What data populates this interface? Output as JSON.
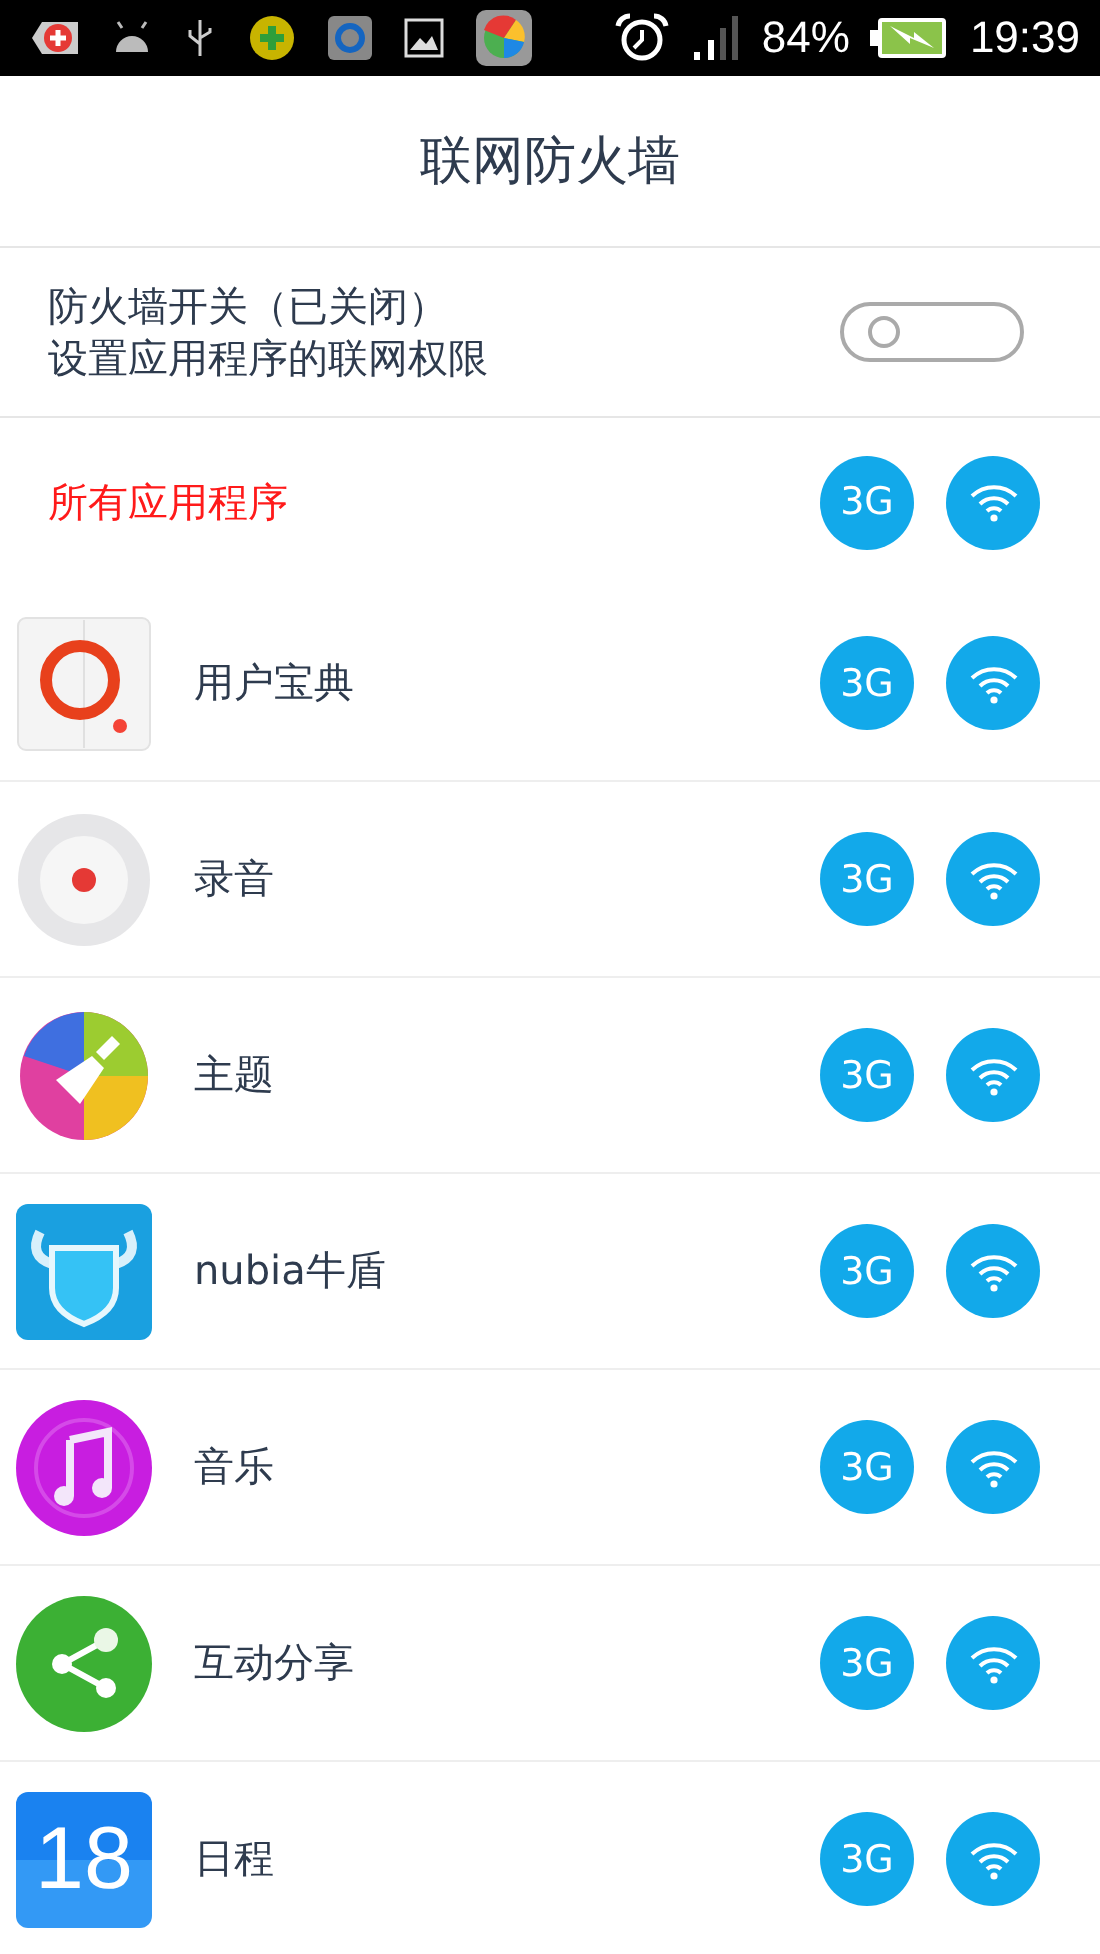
{
  "status_bar": {
    "battery": "84%",
    "time": "19:39"
  },
  "title": "联网防火墙",
  "firewall": {
    "label": "防火墙开关（已关闭）",
    "description": "设置应用程序的联网权限",
    "on": false
  },
  "all_apps": {
    "label": "所有应用程序",
    "mobile_label": "3G",
    "mobile_on": true,
    "wifi_on": true
  },
  "apps": [
    {
      "name": "用户宝典",
      "kind": "book",
      "mobile_label": "3G",
      "mobile_on": true,
      "wifi_on": true
    },
    {
      "name": "录音",
      "kind": "recorder",
      "mobile_label": "3G",
      "mobile_on": true,
      "wifi_on": true
    },
    {
      "name": "主题",
      "kind": "theme",
      "mobile_label": "3G",
      "mobile_on": true,
      "wifi_on": true
    },
    {
      "name": "nubia牛盾",
      "kind": "shield",
      "mobile_label": "3G",
      "mobile_on": true,
      "wifi_on": true
    },
    {
      "name": "音乐",
      "kind": "music",
      "mobile_label": "3G",
      "mobile_on": true,
      "wifi_on": true
    },
    {
      "name": "互动分享",
      "kind": "share",
      "mobile_label": "3G",
      "mobile_on": true,
      "wifi_on": true
    },
    {
      "name": "日程",
      "kind": "calendar",
      "icon_text": "18",
      "mobile_label": "3G",
      "mobile_on": true,
      "wifi_on": true
    }
  ]
}
